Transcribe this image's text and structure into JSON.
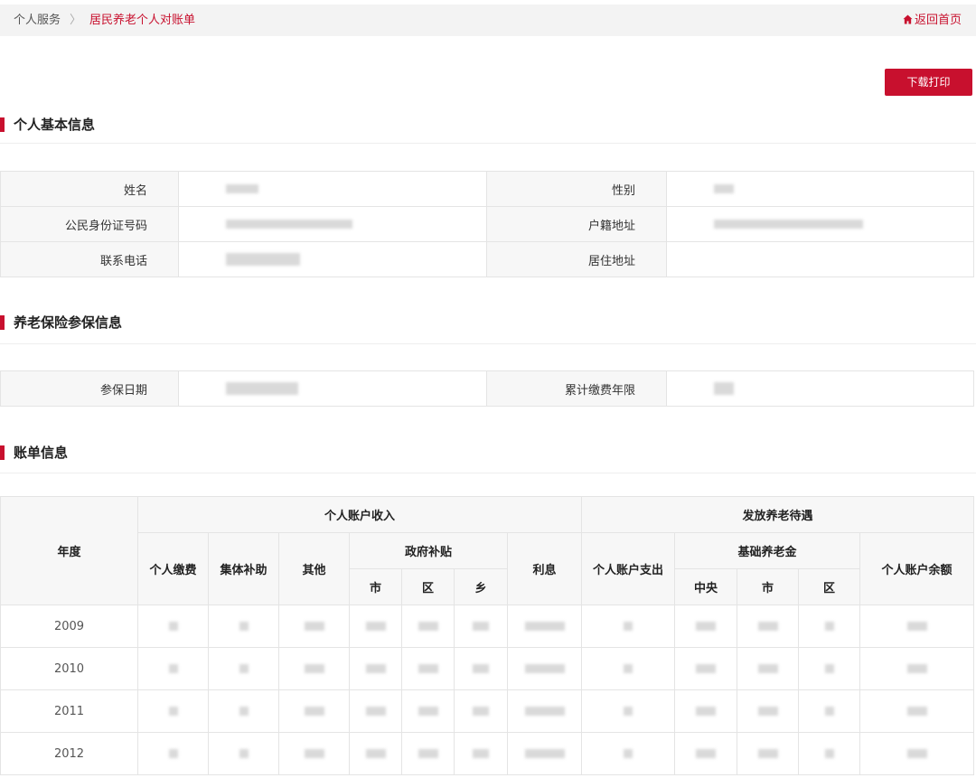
{
  "breadcrumb": {
    "root": "个人服务",
    "separator": "〉",
    "current": "居民养老个人对账单"
  },
  "home_link": {
    "icon": "home-icon",
    "label": "返回首页"
  },
  "download_button": "下载打印",
  "sections": {
    "basic": "个人基本信息",
    "insurance": "养老保险参保信息",
    "bill": "账单信息"
  },
  "basic_info": {
    "name_label": "姓名",
    "gender_label": "性别",
    "id_label": "公民身份证号码",
    "household_label": "户籍地址",
    "phone_label": "联系电话",
    "residence_label": "居住地址"
  },
  "insurance_info": {
    "enroll_date_label": "参保日期",
    "years_label": "累计缴费年限"
  },
  "bill_table": {
    "headers": {
      "year": "年度",
      "income": "个人账户收入",
      "payout": "发放养老待遇",
      "personal_pay": "个人缴费",
      "collective": "集体补助",
      "other": "其他",
      "gov_subsidy": "政府补贴",
      "city": "市",
      "district": "区",
      "town": "乡",
      "interest": "利息",
      "account_out": "个人账户支出",
      "basic_pension": "基础养老金",
      "central": "中央",
      "city2": "市",
      "district2": "区",
      "balance": "个人账户余额"
    },
    "years": [
      "2009",
      "2010",
      "2011",
      "2012"
    ]
  },
  "colors": {
    "accent": "#c8102e",
    "header_bg": "#f7f7f7",
    "border": "#e4e4e4"
  }
}
